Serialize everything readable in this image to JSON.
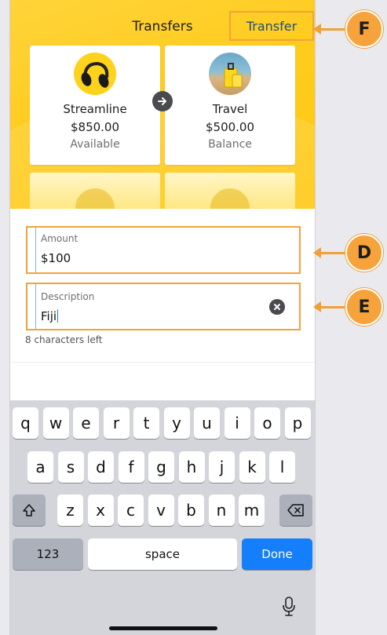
{
  "nav": {
    "title": "Transfers",
    "action_label": "Transfer"
  },
  "accounts": [
    {
      "name": "Streamline",
      "amount": "$850.00",
      "caption": "Available",
      "icon": "headphones-icon"
    },
    {
      "name": "Travel",
      "amount": "$500.00",
      "caption": "Balance",
      "icon": "suitcase-icon"
    }
  ],
  "form": {
    "amount": {
      "label": "Amount",
      "value": "$100"
    },
    "description": {
      "label": "Description",
      "value": "Fiji",
      "helper": "8 characters left"
    }
  },
  "keyboard": {
    "row1": [
      "q",
      "w",
      "e",
      "r",
      "t",
      "y",
      "u",
      "i",
      "o",
      "p"
    ],
    "row2": [
      "a",
      "s",
      "d",
      "f",
      "g",
      "h",
      "j",
      "k",
      "l"
    ],
    "row3": [
      "z",
      "x",
      "c",
      "v",
      "b",
      "n",
      "m"
    ],
    "numbers_label": "123",
    "space_label": "space",
    "done_label": "Done"
  },
  "callouts": {
    "f": "F",
    "d": "D",
    "e": "E"
  },
  "colors": {
    "accent_yellow": "#ffcc1f",
    "highlight_orange": "#f3a23a",
    "keyboard_blue": "#147efb"
  }
}
